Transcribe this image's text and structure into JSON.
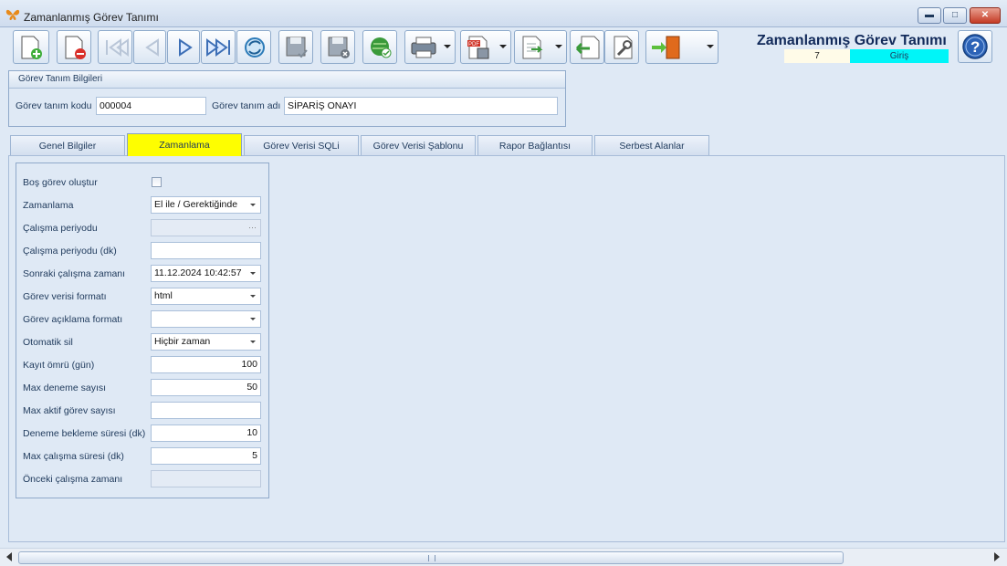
{
  "window": {
    "title": "Zamanlanmış Görev Tanımı"
  },
  "header": {
    "title": "Zamanlanmış Görev Tanımı",
    "record_no": "7",
    "mode": "Giriş"
  },
  "toolbar": {
    "buttons": [
      "new-record-icon",
      "delete-record-icon",
      "first-record-icon",
      "previous-record-icon",
      "next-record-icon",
      "last-record-icon",
      "refresh-icon",
      "save-icon",
      "save-cancel-icon",
      "web-approve-icon",
      "print-icon",
      "pdf-export-icon",
      "export-icon",
      "back-icon",
      "settings-wrench-icon",
      "exit-door-icon",
      "help-icon"
    ]
  },
  "group": {
    "title": "Görev Tanım Bilgileri",
    "code_label": "Görev tanım kodu",
    "code_value": "000004",
    "name_label": "Görev tanım adı",
    "name_value": "SİPARİŞ ONAYI"
  },
  "tabs": [
    "Genel Bilgiler",
    "Zamanlama",
    "Görev Verisi SQLi",
    "Görev Verisi Şablonu",
    "Rapor Bağlantısı",
    "Serbest Alanlar"
  ],
  "active_tab": "Zamanlama",
  "form": {
    "bos_gorev": {
      "label": "Boş görev oluştur",
      "checked": false
    },
    "zamanlama": {
      "label": "Zamanlama",
      "value": "El ile / Gerektiğinde"
    },
    "calisma_periyodu": {
      "label": "Çalışma periyodu",
      "value": ""
    },
    "calisma_periyodu_dk": {
      "label": "Çalışma periyodu (dk)",
      "value": ""
    },
    "sonraki_calisma": {
      "label": "Sonraki çalışma zamanı",
      "value": "11.12.2024 10:42:57"
    },
    "gorev_verisi_formati": {
      "label": "Görev verisi formatı",
      "value": "html"
    },
    "gorev_aciklama_formati": {
      "label": "Görev açıklama formatı",
      "value": ""
    },
    "otomatik_sil": {
      "label": "Otomatik sil",
      "value": "Hiçbir zaman"
    },
    "kayit_omru": {
      "label": "Kayıt ömrü (gün)",
      "value": "100"
    },
    "max_deneme": {
      "label": "Max deneme sayısı",
      "value": "50"
    },
    "max_aktif": {
      "label": "Max aktif görev sayısı",
      "value": ""
    },
    "deneme_bekleme": {
      "label": "Deneme bekleme süresi (dk)",
      "value": "10"
    },
    "max_calisma": {
      "label": "Max çalışma süresi (dk)",
      "value": "5"
    },
    "onceki_calisma": {
      "label": "Önceki çalışma zamanı",
      "value": ""
    }
  },
  "colors": {
    "active_tab": "#fefe00",
    "mode_badge": "#00f5f8",
    "background": "#dfe9f5"
  }
}
